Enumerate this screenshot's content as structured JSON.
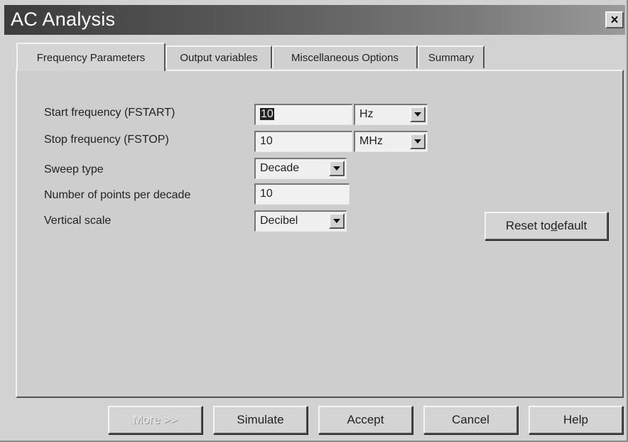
{
  "window": {
    "title": "AC Analysis",
    "close_glyph": "×"
  },
  "tabs": [
    {
      "label": "Frequency Parameters",
      "active": true
    },
    {
      "label": "Output variables",
      "active": false
    },
    {
      "label": "Miscellaneous Options",
      "active": false
    },
    {
      "label": "Summary",
      "active": false
    }
  ],
  "form": {
    "start_frequency": {
      "label": "Start frequency (FSTART)",
      "value": "10",
      "unit": "Hz"
    },
    "stop_frequency": {
      "label": "Stop frequency (FSTOP)",
      "value": "10",
      "unit": "MHz"
    },
    "sweep_type": {
      "label": "Sweep type",
      "value": "Decade"
    },
    "points_per_decade": {
      "label": "Number of points per decade",
      "value": "10"
    },
    "vertical_scale": {
      "label": "Vertical scale",
      "value": "Decibel"
    }
  },
  "reset_button": {
    "label_prefix": "Reset to ",
    "label_underlined": "d",
    "label_suffix": "efault"
  },
  "footer_buttons": {
    "more": "More >>",
    "simulate": "Simulate",
    "accept": "Accept",
    "cancel": "Cancel",
    "help": "Help"
  },
  "icons": {
    "dropdown": "chevron-down-icon",
    "close": "close-icon"
  }
}
